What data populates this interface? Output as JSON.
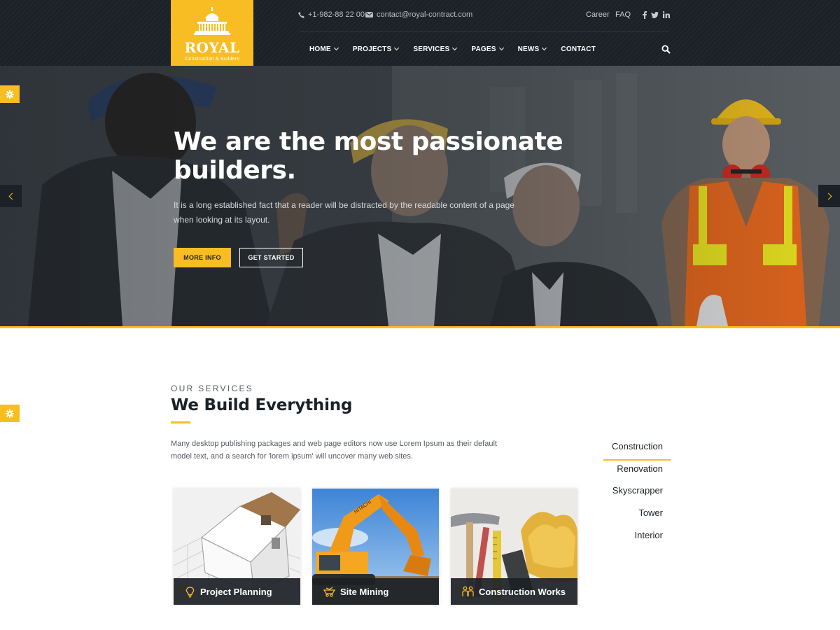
{
  "brand": {
    "name": "ROYAL",
    "tagline": "Construction & Builders",
    "color": "#f9bd24",
    "dark": "#1b2126",
    "icon": "capitol-building-icon"
  },
  "topbar": {
    "phone": "+1-982-88 22 00",
    "email": "contact@royal-contract.com",
    "links": [
      "Career",
      "FAQ"
    ],
    "social": [
      "facebook-icon",
      "twitter-icon",
      "linkedin-icon"
    ]
  },
  "nav": {
    "items": [
      {
        "label": "HOME",
        "dropdown": true
      },
      {
        "label": "PROJECTS",
        "dropdown": true
      },
      {
        "label": "SERVICES",
        "dropdown": true
      },
      {
        "label": "PAGES",
        "dropdown": true
      },
      {
        "label": "NEWS",
        "dropdown": true
      },
      {
        "label": "CONTACT",
        "dropdown": false
      }
    ],
    "search_icon": "search-icon"
  },
  "hero": {
    "title": "We are the most passionate builders.",
    "text": "It is a long established fact that a reader will be distracted by the readable content of a page when looking at its layout.",
    "primary_button": "MORE INFO",
    "secondary_button": "GET STARTED"
  },
  "services": {
    "eyebrow": "OUR SERVICES",
    "title": "We Build Everything",
    "description": "Many desktop publishing packages and web page editors now use Lorem Ipsum as their default model text, and a search for 'lorem ipsum' will uncover many web sites.",
    "tabs": [
      {
        "label": "Construction",
        "active": true
      },
      {
        "label": "Renovation",
        "active": false
      },
      {
        "label": "Skyscrapper",
        "active": false
      },
      {
        "label": "Tower",
        "active": false
      },
      {
        "label": "Interior",
        "active": false
      }
    ],
    "cards": [
      {
        "label": "Project Planning",
        "icon": "lightbulb-icon"
      },
      {
        "label": "Site Mining",
        "icon": "mining-cart-icon"
      },
      {
        "label": "Construction Works",
        "icon": "workers-icon"
      }
    ]
  }
}
